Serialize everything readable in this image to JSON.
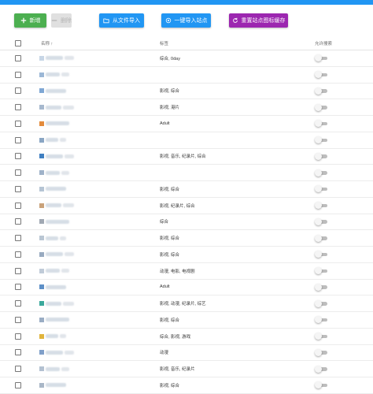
{
  "toolbar": {
    "add_label": "新增",
    "delete_label": "删除",
    "import_file_label": "从文件导入",
    "one_click_import_label": "一键导入站点",
    "reset_icon_cache_label": "重置站点图标缓存"
  },
  "table": {
    "headers": {
      "name": "名称 ↑",
      "tags": "标签",
      "allow_search": "允许搜索"
    },
    "rows": [
      {
        "tags": "综合, 0day",
        "logo_color": "#c7d6e6",
        "allow_search": false
      },
      {
        "tags": "",
        "logo_color": "#9bb7d6",
        "allow_search": false
      },
      {
        "tags": "影视, 综合",
        "logo_color": "#7fa7d4",
        "allow_search": false
      },
      {
        "tags": "影视, 港片",
        "logo_color": "#a6b8ce",
        "allow_search": false
      },
      {
        "tags": "Adult",
        "logo_color": "#e38b3c",
        "allow_search": false
      },
      {
        "tags": "",
        "logo_color": "#8aa6c4",
        "allow_search": false
      },
      {
        "tags": "影视, 音乐, 纪录片, 综合",
        "logo_color": "#3f7fc1",
        "allow_search": false
      },
      {
        "tags": "",
        "logo_color": "#9fb2c9",
        "allow_search": false
      },
      {
        "tags": "影视, 综合",
        "logo_color": "#b5c4d4",
        "allow_search": false
      },
      {
        "tags": "影视, 纪录片, 综合",
        "logo_color": "#c9a27a",
        "allow_search": false
      },
      {
        "tags": "综合",
        "logo_color": "#a0a8b3",
        "allow_search": false
      },
      {
        "tags": "影视, 综合",
        "logo_color": "#b9c6d3",
        "allow_search": false
      },
      {
        "tags": "影视, 综合",
        "logo_color": "#98aac0",
        "allow_search": false
      },
      {
        "tags": "动漫, 电影, 电视剧",
        "logo_color": "#c0cbd8",
        "allow_search": false
      },
      {
        "tags": "Adult",
        "logo_color": "#5d8fc7",
        "allow_search": false
      },
      {
        "tags": "影视, 动漫, 纪录片, 综艺",
        "logo_color": "#3aa89c",
        "allow_search": false
      },
      {
        "tags": "影视, 综合",
        "logo_color": "#9aadc4",
        "allow_search": false
      },
      {
        "tags": "综合, 影视, 游戏",
        "logo_color": "#e0b43c",
        "allow_search": false
      },
      {
        "tags": "动漫",
        "logo_color": "#7f9fc9",
        "allow_search": false
      },
      {
        "tags": "影视, 音乐, 纪录片",
        "logo_color": "#b3c1d1",
        "allow_search": false
      },
      {
        "tags": "影视, 综合",
        "logo_color": "#a9b7c7",
        "allow_search": false
      }
    ]
  },
  "colors": {
    "accent": "#2196f3",
    "add": "#4caf50",
    "reset": "#9c27b0",
    "disabled": "#e0e0e0"
  }
}
